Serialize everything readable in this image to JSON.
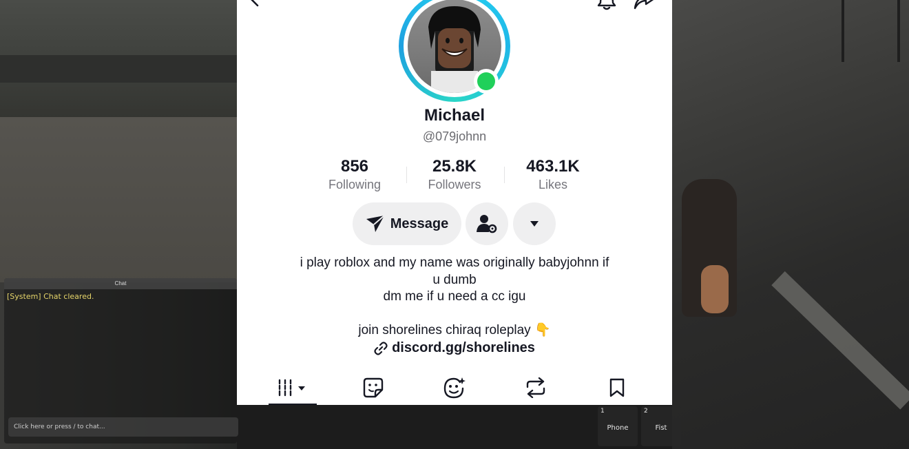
{
  "profile": {
    "name": "Michael",
    "handle": "@079johnn",
    "stats": [
      {
        "value": "856",
        "label": "Following"
      },
      {
        "value": "25.8K",
        "label": "Followers"
      },
      {
        "value": "463.1K",
        "label": "Likes"
      }
    ],
    "message_label": "Message",
    "bio_lines": [
      "i play roblox and my name was originally babyjohnn if",
      "u dumb",
      "dm me if u need a cc igu",
      "join shorelines chiraq roleplay 👇"
    ],
    "link": "discord.gg/shorelines",
    "online": true
  },
  "tabs": [
    {
      "icon": "videos-grid-icon",
      "active": true
    },
    {
      "icon": "stickers-icon",
      "active": false
    },
    {
      "icon": "liked-face-icon",
      "active": false
    },
    {
      "icon": "repost-icon",
      "active": false
    },
    {
      "icon": "bookmark-icon",
      "active": false
    }
  ],
  "game": {
    "chat": {
      "title": "Chat",
      "message": "[System] Chat cleared.",
      "input_placeholder": "Click here or press / to chat..."
    },
    "hotbar": [
      {
        "number": "1",
        "label": "Phone"
      },
      {
        "number": "2",
        "label": "Fist"
      }
    ]
  },
  "colors": {
    "ring": "#25d0f0",
    "online": "#20d05a",
    "chat_system": "#e6d56a"
  }
}
